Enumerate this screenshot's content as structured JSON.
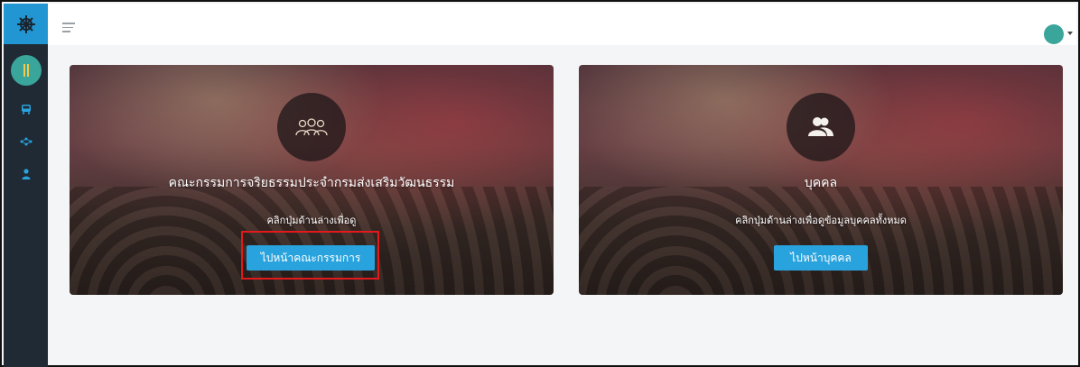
{
  "topbar": {
    "menu_icon": "menu-icon",
    "user_avatar_icon": "avatar"
  },
  "sidebar": {
    "logo_icon": "ship-wheel-icon",
    "items": [
      {
        "icon": "bus-icon"
      },
      {
        "icon": "network-icon"
      },
      {
        "icon": "user-icon"
      }
    ]
  },
  "cards": [
    {
      "icon": "group-outline-icon",
      "title": "คณะกรรมการจริยธรรมประจำกรมส่งเสริมวัฒนธรรม",
      "description": "คลิกปุ่มด้านล่างเพื่อดู",
      "button_label": "ไปหน้าคณะกรรมการ"
    },
    {
      "icon": "users-icon",
      "title": "บุคคล",
      "description": "คลิกปุ่มด้านล่างเพื่อดูข้อมูลบุคคลทั้งหมด",
      "button_label": "ไปหน้าบุคคล"
    }
  ],
  "colors": {
    "sidebar_bg": "#1f2a35",
    "logo_bg": "#2196d3",
    "button_bg": "#29a3de",
    "highlight": "#e3191b"
  }
}
